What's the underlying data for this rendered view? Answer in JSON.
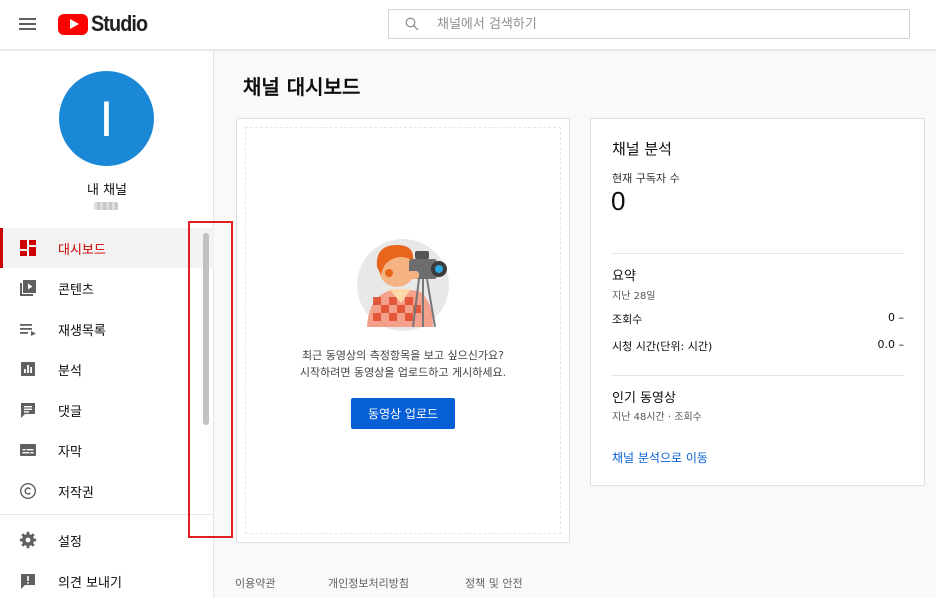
{
  "header": {
    "logo_text": "Studio",
    "search_placeholder": "채널에서 검색하기"
  },
  "sidebar": {
    "avatar_letter": "I",
    "channel_name": "내 채널",
    "items": [
      {
        "label": "대시보드",
        "icon": "dashboard-icon",
        "active": true
      },
      {
        "label": "콘텐츠",
        "icon": "content-icon"
      },
      {
        "label": "재생목록",
        "icon": "playlist-icon"
      },
      {
        "label": "분석",
        "icon": "analytics-icon"
      },
      {
        "label": "댓글",
        "icon": "comments-icon"
      },
      {
        "label": "자막",
        "icon": "subtitles-icon"
      },
      {
        "label": "저작권",
        "icon": "copyright-icon"
      },
      {
        "label": "설정",
        "icon": "gear-icon"
      },
      {
        "label": "의견 보내기",
        "icon": "feedback-icon"
      }
    ]
  },
  "main": {
    "title": "채널 대시보드",
    "upload_card": {
      "message_line1": "최근 동영상의 측정항목을 보고 싶으신가요?",
      "message_line2": "시작하려면 동영상을 업로드하고 게시하세요.",
      "button_label": "동영상 업로드"
    },
    "analytics_card": {
      "title": "채널 분석",
      "subscribers_label": "현재 구독자 수",
      "subscribers_value": "0",
      "summary_title": "요약",
      "summary_period": "지난 28일",
      "views_label": "조회수",
      "views_value": "0 –",
      "watch_time_label": "시청 시간(단위: 시간)",
      "watch_time_value": "0.0 –",
      "popular_title": "인기 동영상",
      "popular_period": "지난 48시간 · 조회수",
      "link_label": "채널 분석으로 이동"
    },
    "footer": [
      "이용약관",
      "개인정보처리방침",
      "정책 및 안전"
    ]
  },
  "colors": {
    "accent": "#065fd4",
    "active": "#cc0000",
    "avatar": "#1a88d6",
    "brand": "#ff0000"
  }
}
